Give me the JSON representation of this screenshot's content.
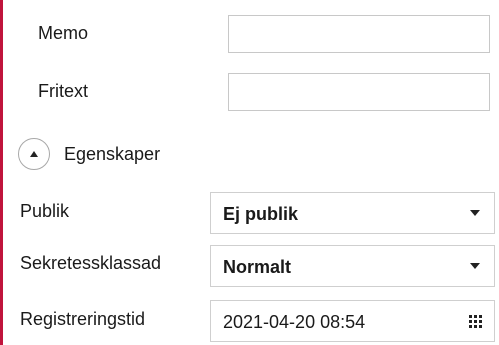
{
  "fields": {
    "memo": {
      "label": "Memo",
      "value": ""
    },
    "fritext": {
      "label": "Fritext",
      "value": ""
    }
  },
  "section": {
    "title": "Egenskaper",
    "expand_icon": "chevron-up-icon"
  },
  "properties": {
    "publik": {
      "label": "Publik",
      "value": "Ej publik"
    },
    "sekretess": {
      "label": "Sekretessklassad",
      "value": "Normalt"
    },
    "registreringstid": {
      "label": "Registreringstid",
      "value": "2021-04-20 08:54",
      "icon": "calendar-icon"
    }
  },
  "colors": {
    "accent": "#c0143c",
    "border": "#c8c8c8"
  }
}
